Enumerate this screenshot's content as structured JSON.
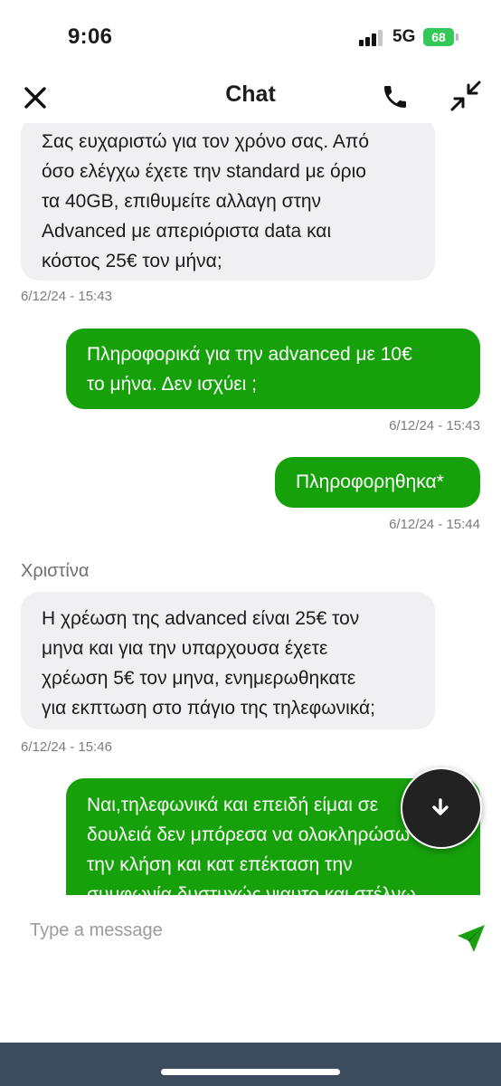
{
  "status_bar": {
    "time": "9:06",
    "network": "5G",
    "battery": "68"
  },
  "header": {
    "title": "Chat",
    "close_icon": "close-icon",
    "phone_icon": "phone-icon",
    "minimize_icon": "minimize-icon"
  },
  "messages": [
    {
      "direction": "incoming",
      "lines": [
        "Σας ευχαριστώ για τον χρόνο σας. Από",
        "όσο ελέγχω έχετε την standard με όριο",
        "τα 40GB, επιθυμείτε αλλαγη στην",
        "Advanced με απεριόριστα data και",
        "κόστος 25€ τον μήνα;"
      ],
      "timestamp": "6/12/24 - 15:43"
    },
    {
      "direction": "outgoing",
      "lines": [
        "Πληροφορικά για την advanced με 10€",
        "το μήνα. Δεν ισχύει ;"
      ],
      "timestamp": "6/12/24 - 15:43"
    },
    {
      "direction": "outgoing",
      "lines": [
        "Πληροφορηθηκα*"
      ],
      "timestamp": "6/12/24 - 15:44"
    },
    {
      "direction": "incoming",
      "sender": "Χριστίνα",
      "lines": [
        "Η χρέωση της advanced είναι 25€ τον",
        "μηνα και για την υπαρχουσα έχετε",
        "χρέωση 5€ τον μηνα, ενημερωθηκατε",
        "για εκπτωση στο πάγιο της τηλεφωνικά;"
      ],
      "timestamp": "6/12/24 - 15:46"
    },
    {
      "direction": "outgoing",
      "lines": [
        "Ναι,τηλεφωνικά και επειδή είμαι σε",
        "δουλειά δεν μπόρεσα να ολοκληρώσω",
        "την κλήση και κατ επέκταση την",
        "συμφωνία δυστυχώς νιαυτο και στέλνω"
      ]
    }
  ],
  "scroll_down_icon": "arrow-down-icon",
  "composer": {
    "placeholder": "Type a message",
    "send_icon": "send-icon"
  },
  "colors": {
    "outgoing_bubble": "#16a10b",
    "incoming_bubble": "#f0f0f2",
    "battery": "#34c759",
    "bottom_bar": "#3d4b5f"
  }
}
